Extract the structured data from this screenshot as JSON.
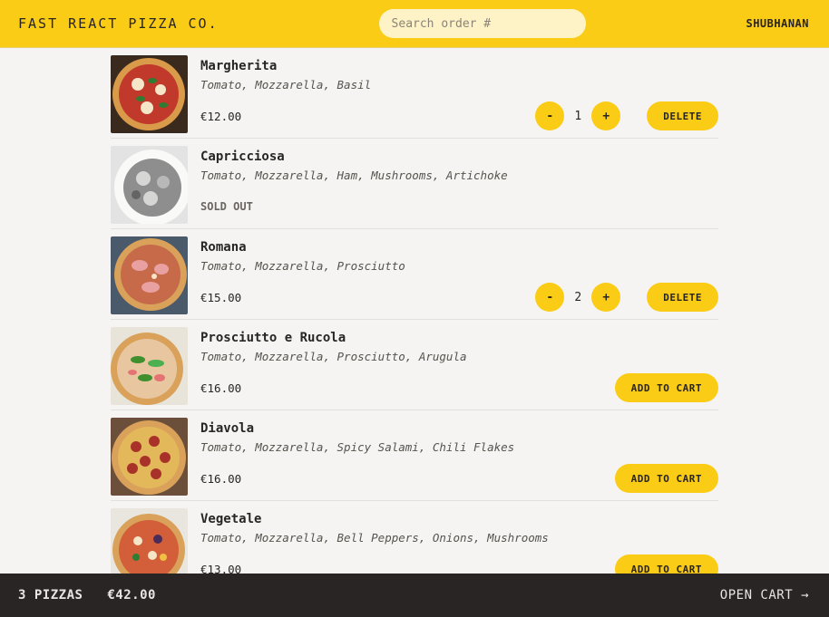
{
  "header": {
    "logo": "FAST REACT PIZZA CO.",
    "search_placeholder": "Search order #",
    "username": "SHUBHANAN"
  },
  "menu": [
    {
      "name": "Margherita",
      "ingredients": "Tomato, Mozzarella, Basil",
      "price": "€12.00",
      "status": "in_cart",
      "quantity": "1",
      "decrease_label": "-",
      "increase_label": "+",
      "action_label": "DELETE"
    },
    {
      "name": "Capricciosa",
      "ingredients": "Tomato, Mozzarella, Ham, Mushrooms, Artichoke",
      "sold_out_label": "SOLD OUT",
      "status": "sold_out"
    },
    {
      "name": "Romana",
      "ingredients": "Tomato, Mozzarella, Prosciutto",
      "price": "€15.00",
      "status": "in_cart",
      "quantity": "2",
      "decrease_label": "-",
      "increase_label": "+",
      "action_label": "DELETE"
    },
    {
      "name": "Prosciutto e Rucola",
      "ingredients": "Tomato, Mozzarella, Prosciutto, Arugula",
      "price": "€16.00",
      "status": "available",
      "action_label": "ADD TO CART"
    },
    {
      "name": "Diavola",
      "ingredients": "Tomato, Mozzarella, Spicy Salami, Chili Flakes",
      "price": "€16.00",
      "status": "available",
      "action_label": "ADD TO CART"
    },
    {
      "name": "Vegetale",
      "ingredients": "Tomato, Mozzarella, Bell Peppers, Onions, Mushrooms",
      "price": "€13.00",
      "status": "available",
      "action_label": "ADD TO CART"
    }
  ],
  "footer": {
    "pizza_count": "3 PIZZAS",
    "total": "€42.00",
    "open_cart": "OPEN CART →"
  },
  "colors": {
    "accent": "#facc15",
    "footer_bg": "#292524",
    "page_bg": "#f5f4f2"
  }
}
